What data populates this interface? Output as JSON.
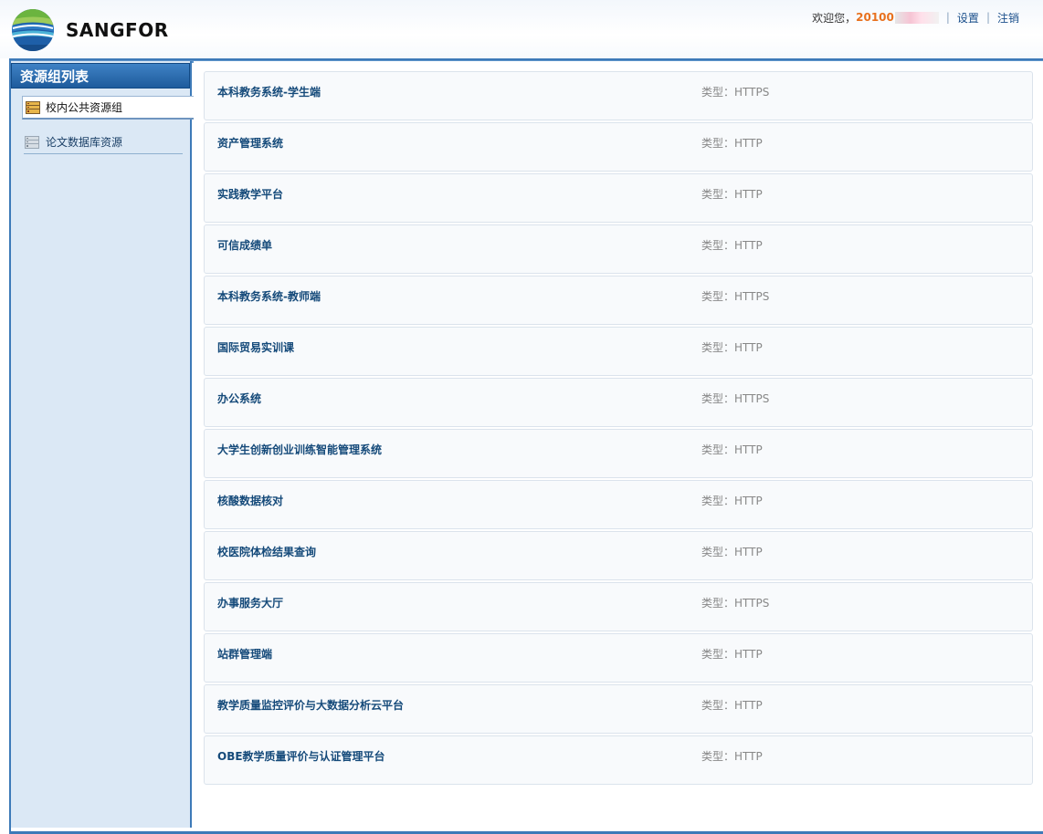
{
  "header": {
    "brand": "SANGFOR",
    "welcome": "欢迎您，",
    "username_visible": "20100",
    "settings_label": "设置",
    "logout_label": "注销",
    "separator": "|"
  },
  "sidebar": {
    "title": "资源组列表",
    "groups": [
      {
        "label": "校内公共资源组",
        "selected": true
      },
      {
        "label": "论文数据库资源",
        "selected": false
      }
    ]
  },
  "resources": {
    "type_prefix": "类型：",
    "items": [
      {
        "name": "本科教务系统-学生端",
        "type": "HTTPS"
      },
      {
        "name": "资产管理系统",
        "type": "HTTP"
      },
      {
        "name": "实践教学平台",
        "type": "HTTP"
      },
      {
        "name": "可信成绩单",
        "type": "HTTP"
      },
      {
        "name": "本科教务系统-教师端",
        "type": "HTTPS"
      },
      {
        "name": "国际贸易实训课",
        "type": "HTTP"
      },
      {
        "name": "办公系统",
        "type": "HTTPS"
      },
      {
        "name": "大学生创新创业训练智能管理系统",
        "type": "HTTP"
      },
      {
        "name": "核酸数据核对",
        "type": "HTTP"
      },
      {
        "name": "校医院体检结果查询",
        "type": "HTTP"
      },
      {
        "name": "办事服务大厅",
        "type": "HTTPS"
      },
      {
        "name": "站群管理端",
        "type": "HTTP"
      },
      {
        "name": "教学质量监控评价与大数据分析云平台",
        "type": "HTTP"
      },
      {
        "name": "OBE教学质量评价与认证管理平台",
        "type": "HTTP"
      }
    ]
  },
  "colors": {
    "accent_blue": "#3d7ab8",
    "sidebar_bg": "#dbe8f5",
    "username_orange": "#e8711e",
    "resource_name": "#154a7a"
  },
  "icons": {
    "logo": "globe-logo-icon",
    "group_selected": "server-rack-icon",
    "group_default": "database-grid-icon"
  }
}
